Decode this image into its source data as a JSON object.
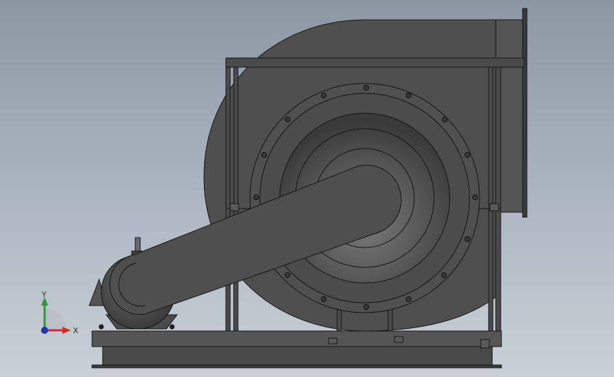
{
  "viewport": {
    "background_top": "#8d97a4",
    "background_bottom": "#c9d0d7"
  },
  "model": {
    "description_icon": "centrifugal-fan-assembly",
    "body_color": "#4d4d4d",
    "edge_color": "#141414"
  },
  "triad": {
    "x_label": "X",
    "y_label": "Y",
    "x_color": "#d12c2c",
    "y_color": "#2d9a3a",
    "z_color": "#2233aa"
  }
}
